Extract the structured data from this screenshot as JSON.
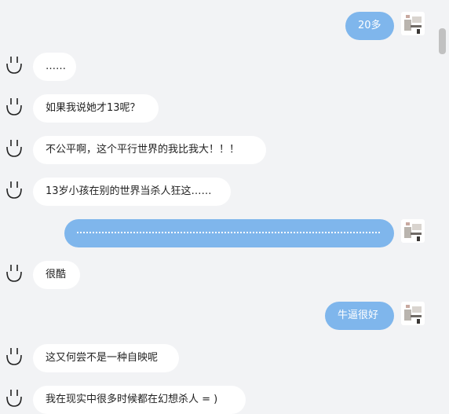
{
  "messages": [
    {
      "side": "right",
      "text": "20多"
    },
    {
      "side": "left",
      "text": "……"
    },
    {
      "side": "left",
      "text": "如果我说她才13呢？"
    },
    {
      "side": "left",
      "text": "不公平啊，这个平行世界的我比我大！！！"
    },
    {
      "side": "left",
      "text": "13岁小孩在别的世界当杀人狂这……"
    },
    {
      "side": "right",
      "text": "",
      "dotted": true
    },
    {
      "side": "left",
      "text": "很酷"
    },
    {
      "side": "right",
      "text": "牛逼很好"
    },
    {
      "side": "left",
      "text": "这又何尝不是一种自映呢"
    },
    {
      "side": "left",
      "text": "我在现实中很多时候都在幻想杀人 = )"
    }
  ],
  "colors": {
    "background": "#f2f3f5",
    "left_bubble": "#ffffff",
    "right_bubble": "#7fb6ec"
  },
  "icons": {
    "left_avatar": "smiley-face-icon",
    "right_avatar": "user-photo-avatar"
  }
}
